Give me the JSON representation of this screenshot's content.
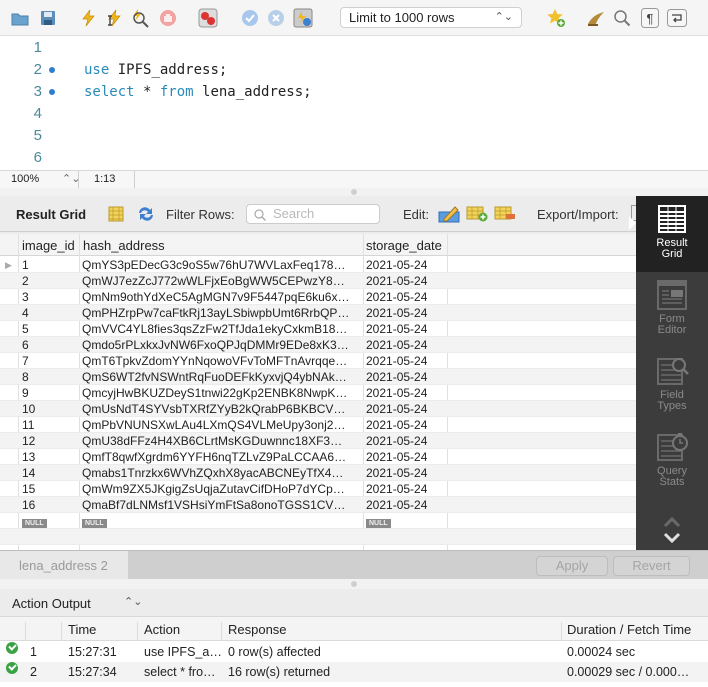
{
  "toolbar": {
    "limit_select": "Limit to 1000 rows",
    "icons": [
      "folder-open-icon",
      "save-icon",
      "execute-icon",
      "execute-current-icon",
      "explain-icon",
      "stop-icon",
      "toggle-error-icon",
      "commit-icon",
      "rollback-icon",
      "autocommit-icon",
      "add-snippet-icon",
      "beautify-icon",
      "find-icon",
      "invisible-chars-icon",
      "word-wrap-icon"
    ]
  },
  "editor": {
    "lines": [
      {
        "number": "1",
        "marker": false,
        "tokens": []
      },
      {
        "number": "2",
        "marker": true,
        "tokens": [
          {
            "text": "use",
            "kw": true
          },
          {
            "text": " IPFS_address;",
            "kw": false
          }
        ]
      },
      {
        "number": "3",
        "marker": true,
        "tokens": [
          {
            "text": "select",
            "kw": true
          },
          {
            "text": " * ",
            "kw": false
          },
          {
            "text": "from",
            "kw": true
          },
          {
            "text": " lena_address;",
            "kw": false
          }
        ]
      },
      {
        "number": "4",
        "marker": false,
        "tokens": []
      },
      {
        "number": "5",
        "marker": false,
        "tokens": []
      },
      {
        "number": "6",
        "marker": false,
        "tokens": []
      }
    ],
    "zoom": "100%",
    "cursor_position": "1:13"
  },
  "result_toolbar": {
    "title": "Result Grid",
    "filter_label": "Filter Rows:",
    "search_placeholder": "Search",
    "edit_label": "Edit:",
    "export_label": "Export/Import:"
  },
  "grid": {
    "columns": [
      "image_id",
      "hash_address",
      "storage_date"
    ],
    "rows": [
      [
        "1",
        "QmYS3pEDecG3c9oS5w76hU7WVLaxFeq178…",
        "2021-05-24"
      ],
      [
        "2",
        "QmWJ7ezZcJ772wWLFjxEoBgWW5CEPwzY8…",
        "2021-05-24"
      ],
      [
        "3",
        "QmNm9othYdXeC5AgMGN7v9F5447pqE6ku6x…",
        "2021-05-24"
      ],
      [
        "4",
        "QmPHZrpPw7caFtkRj13ayLSbiwpbUmt6RrbQP…",
        "2021-05-24"
      ],
      [
        "5",
        "QmVVC4YL8fies3qsZzFw2TfJda1ekyCxkmB18…",
        "2021-05-24"
      ],
      [
        "6",
        "Qmdo5rPLxkxJvNW6FxoQPJqDMMr9EDe8xK3…",
        "2021-05-24"
      ],
      [
        "7",
        "QmT6TpkvZdomYYnNqowoVFvToMFTnAvrqqe…",
        "2021-05-24"
      ],
      [
        "8",
        "QmS6WT2fvNSWntRqFuoDEFkKyxvjQ4ybNAk…",
        "2021-05-24"
      ],
      [
        "9",
        "QmcyjHwBKUZDeyS1tnwi22gKp2ENBK8NwpK…",
        "2021-05-24"
      ],
      [
        "10",
        "QmUsNdT4SYVsbTXRfZYyB2kQrabP6BKBCV…",
        "2021-05-24"
      ],
      [
        "11",
        "QmPbVNUNSXwLAu4LXmQS4VLMeUpy3onj2…",
        "2021-05-24"
      ],
      [
        "12",
        "QmU38dFFz4H4XB6CLrtMsKGDuwnnc18XF3…",
        "2021-05-24"
      ],
      [
        "13",
        "QmfT8qwfXgrdm6YYFH6nqTZLvZ9PaLCCAA6…",
        "2021-05-24"
      ],
      [
        "14",
        "Qmabs1Tnrzkx6WVhZQxhX8yacABCNEyTfX4…",
        "2021-05-24"
      ],
      [
        "15",
        "QmWm9ZX5JKgigZsUqjaZutavCifDHoP7dYCp…",
        "2021-05-24"
      ],
      [
        "16",
        "QmaBf7dLNMsf1VSHsiYmFtSa8onoTGSS1CV…",
        "2021-05-24"
      ]
    ],
    "null_label": "NULL"
  },
  "side_panel": {
    "items": [
      {
        "label_1": "Result",
        "label_2": "Grid",
        "active": true
      },
      {
        "label_1": "Form",
        "label_2": "Editor",
        "active": false
      },
      {
        "label_1": "Field",
        "label_2": "Types",
        "active": false
      },
      {
        "label_1": "Query",
        "label_2": "Stats",
        "active": false
      }
    ]
  },
  "tab_row": {
    "result_tab": "lena_address 2",
    "apply": "Apply",
    "revert": "Revert"
  },
  "action_output": {
    "title": "Action Output",
    "columns": [
      "Time",
      "Action",
      "Response",
      "Duration / Fetch Time"
    ],
    "rows": [
      {
        "num": "1",
        "time": "15:27:31",
        "action": "use IPFS_a…",
        "response": "0 row(s) affected",
        "duration": "0.00024 sec"
      },
      {
        "num": "2",
        "time": "15:27:34",
        "action": "select * fro…",
        "response": "16 row(s) returned",
        "duration": "0.00029 sec / 0.000…"
      }
    ]
  }
}
